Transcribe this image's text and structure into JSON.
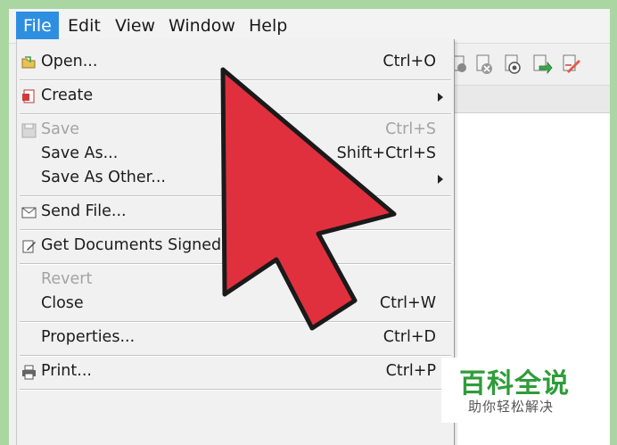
{
  "menubar": {
    "items": [
      {
        "label": "File",
        "active": true
      },
      {
        "label": "Edit"
      },
      {
        "label": "View"
      },
      {
        "label": "Window"
      },
      {
        "label": "Help"
      }
    ]
  },
  "toolbar": {
    "icons": [
      "stamp-icon",
      "delete-file-icon",
      "secure-file-icon",
      "export-icon",
      "sign-icon"
    ]
  },
  "file_menu": {
    "open": {
      "label": "Open...",
      "shortcut": "Ctrl+O"
    },
    "create": {
      "label": "Create"
    },
    "save": {
      "label": "Save",
      "shortcut": "Ctrl+S",
      "disabled": true
    },
    "save_as": {
      "label": "Save As...",
      "shortcut": "Shift+Ctrl+S"
    },
    "save_as_other": {
      "label": "Save As Other..."
    },
    "send_file": {
      "label": "Send File..."
    },
    "get_signed": {
      "label": "Get Documents Signed..."
    },
    "revert": {
      "label": "Revert",
      "disabled": true
    },
    "close": {
      "label": "Close",
      "shortcut": "Ctrl+W"
    },
    "properties": {
      "label": "Properties...",
      "shortcut": "Ctrl+D"
    },
    "print": {
      "label": "Print...",
      "shortcut": "Ctrl+P"
    }
  },
  "overlay": {
    "arrow_color": "#e0303e",
    "arrow_outline": "#1a1a1a"
  },
  "watermark": {
    "title": "百科全说",
    "subtitle": "助你轻松解决"
  },
  "colors": {
    "accent": "#2e8fe0",
    "background": "#a9d6a1",
    "watermark_green": "#2f9c3a"
  }
}
